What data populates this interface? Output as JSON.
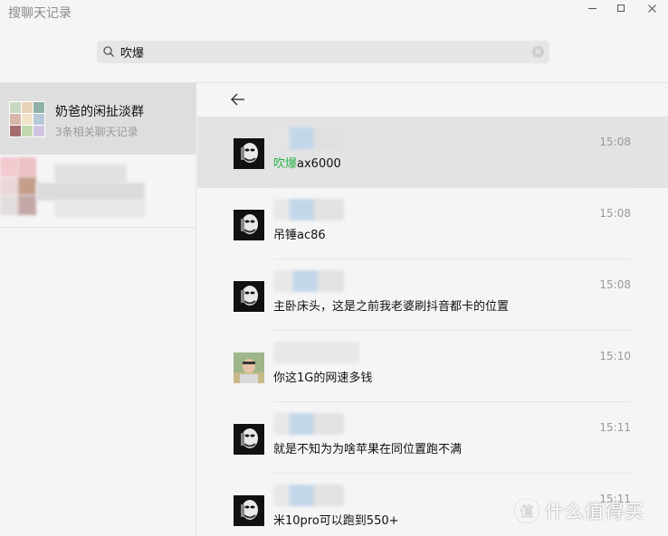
{
  "window": {
    "title": "搜聊天记录"
  },
  "search": {
    "value": "吹爆",
    "placeholder": ""
  },
  "conversations": [
    {
      "name": "奶爸的闲扯淡群",
      "subtitle": "3条相关聊天记录",
      "active": true
    }
  ],
  "messages": [
    {
      "highlight_part": "吹爆",
      "rest": "ax6000",
      "time": "15:08",
      "selected": true
    },
    {
      "highlight_part": "",
      "rest": "吊锤ac86",
      "time": "15:08",
      "selected": false
    },
    {
      "highlight_part": "",
      "rest": "主卧床头，这是之前我老婆刷抖音都卡的位置",
      "time": "15:08",
      "selected": false
    },
    {
      "highlight_part": "",
      "rest": "你这1G的网速多钱",
      "time": "15:10",
      "selected": false
    },
    {
      "highlight_part": "",
      "rest": "就是不知为为啥苹果在同位置跑不满",
      "time": "15:11",
      "selected": false
    },
    {
      "highlight_part": "",
      "rest": "米10pro可以跑到550+",
      "time": "15:11",
      "selected": false
    }
  ],
  "watermark": {
    "text": "什么值得买",
    "logo_glyph": "值"
  },
  "colors": {
    "highlight": "#2bb24c",
    "selected_row": "#e3e3e3",
    "active_conversation": "#dedede"
  },
  "icons": {
    "back": "arrow-left-icon",
    "search": "search-icon",
    "clear": "clear-icon",
    "minimize": "minimize-icon",
    "maximize": "maximize-icon",
    "close": "close-icon"
  }
}
